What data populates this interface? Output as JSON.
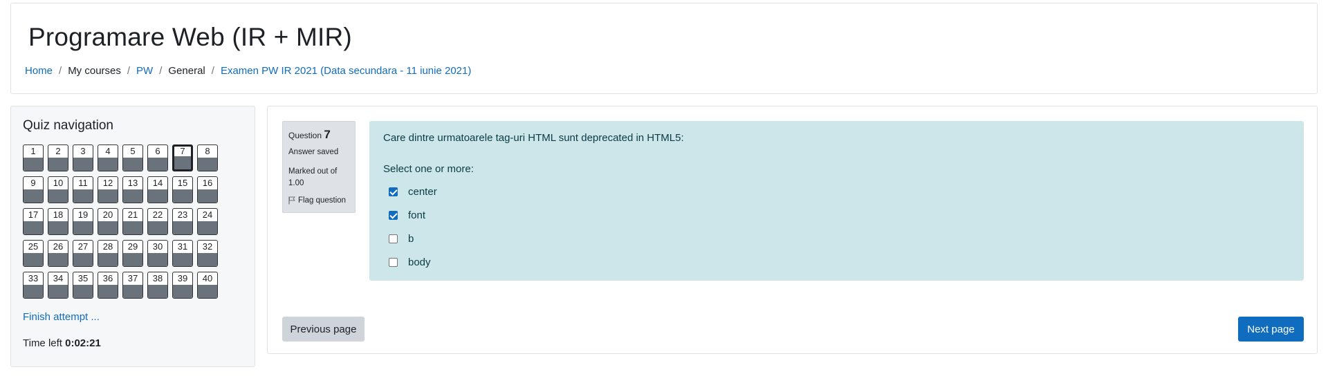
{
  "header": {
    "title": "Programare Web (IR + MIR)",
    "breadcrumb": [
      {
        "label": "Home",
        "link": true
      },
      {
        "label": "My courses",
        "link": false
      },
      {
        "label": "PW",
        "link": true
      },
      {
        "label": "General",
        "link": false
      },
      {
        "label": "Examen PW IR 2021 (Data secundara - 11 iunie 2021)",
        "link": true
      }
    ],
    "separator": "/"
  },
  "quiz_nav": {
    "title": "Quiz navigation",
    "questions": [
      "1",
      "2",
      "3",
      "4",
      "5",
      "6",
      "7",
      "8",
      "9",
      "10",
      "11",
      "12",
      "13",
      "14",
      "15",
      "16",
      "17",
      "18",
      "19",
      "20",
      "21",
      "22",
      "23",
      "24",
      "25",
      "26",
      "27",
      "28",
      "29",
      "30",
      "31",
      "32",
      "33",
      "34",
      "35",
      "36",
      "37",
      "38",
      "39",
      "40"
    ],
    "current_question": "7",
    "finish_label": "Finish attempt ...",
    "time_left_label": "Time left",
    "time_left_value": "0:02:21"
  },
  "question": {
    "label": "Question",
    "number": "7",
    "state": "Answer saved",
    "grade": "Marked out of 1.00",
    "flag_label": "Flag question",
    "flag_icon": "flag-icon",
    "text": "Care dintre urmatoarele tag-uri HTML sunt deprecated in HTML5:",
    "prompt": "Select one or more:",
    "options": [
      {
        "label": "center",
        "checked": true
      },
      {
        "label": "font",
        "checked": true
      },
      {
        "label": "b",
        "checked": false
      },
      {
        "label": "body",
        "checked": false
      }
    ]
  },
  "buttons": {
    "previous": "Previous page",
    "next": "Next page"
  },
  "colors": {
    "link": "#0f6cbf",
    "question_bg": "#cce6ea",
    "answered_fill": "#6a737b",
    "primary_button": "#0f6cbf"
  }
}
